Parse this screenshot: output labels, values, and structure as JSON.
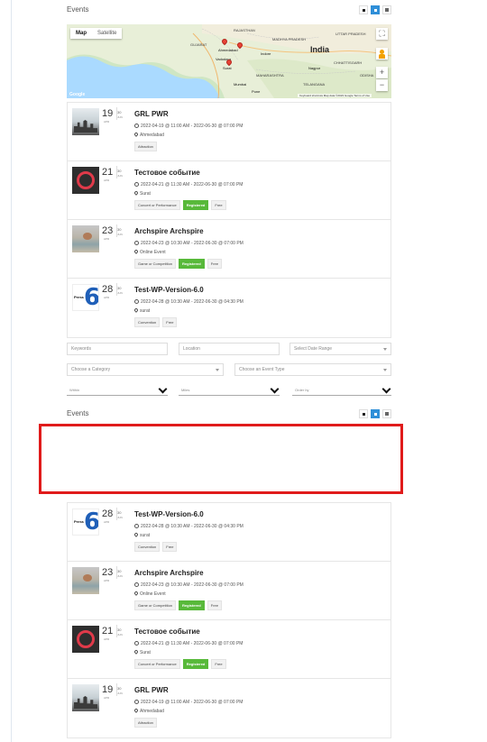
{
  "top_section": {
    "title": "Events",
    "map": {
      "types": [
        "Map",
        "Satellite"
      ],
      "labels": [
        "GUJARAT",
        "Ahmedabad",
        "Surat",
        "MADHYA PRADESH",
        "India",
        "MAHARASHTRA",
        "Nagpur",
        "Mumbai",
        "Pune",
        "RAJASTHAN",
        "UTTAR PRADESH",
        "CHHATTISGARH",
        "Vadodara",
        "Indore",
        "ODISHA",
        "TELANGANA"
      ],
      "footer": "Keyboard shortcuts  Map data ©2023 Google  Terms of Use"
    },
    "events": [
      {
        "day": "19",
        "month": "APR",
        "end_day": "30",
        "end_month": "JUN",
        "title": "GRL PWR",
        "time": "2022-04-19 @ 11:00 AM - 2022-06-30 @ 07:00 PM",
        "location": "Ahmedabad",
        "tags": [
          "Attraction"
        ],
        "registered": false,
        "thumb": "city"
      },
      {
        "day": "21",
        "month": "APR",
        "end_day": "30",
        "end_month": "JUN",
        "title": "Тестовое событие",
        "time": "2022-04-21 @ 11:30 AM - 2022-06-30 @ 07:00 PM",
        "location": "Surat",
        "tags": [
          "Concert or Performance",
          "Registered",
          "Free"
        ],
        "registered": true,
        "thumb": "ring"
      },
      {
        "day": "23",
        "month": "APR",
        "end_day": "30",
        "end_month": "JUN",
        "title": "Archspire Archspire",
        "time": "2022-04-23 @ 10:30 AM - 2022-06-30 @ 07:00 PM",
        "location": "Online Event",
        "tags": [
          "Game or Competition",
          "Registered",
          "Free"
        ],
        "registered": true,
        "thumb": "beach"
      },
      {
        "day": "28",
        "month": "APR",
        "end_day": "30",
        "end_month": "JUN",
        "title": "Test-WP-Version-6.0",
        "time": "2022-04-28 @ 10:30 AM - 2022-06-30 @ 04:30 PM",
        "location": "surat",
        "tags": [
          "Convention",
          "Free"
        ],
        "registered": false,
        "thumb": "logo"
      }
    ]
  },
  "filters": {
    "keywords_placeholder": "Keywords",
    "location_placeholder": "Location",
    "date_range": "Select Date Range",
    "category": "Choose a Category",
    "event_type": "Choose an Event Type",
    "within": "Within",
    "miles": "Miles",
    "order_by": "Order by"
  },
  "bottom_section": {
    "title": "Events",
    "events": [
      {
        "day": "28",
        "month": "APR",
        "end_day": "30",
        "end_month": "JUN",
        "title": "Test-WP-Version-6.0",
        "time": "2022-04-28 @ 10:30 AM - 2022-06-30 @ 04:30 PM",
        "location": "surat",
        "tags": [
          "Convention",
          "Free"
        ],
        "thumb": "logo"
      },
      {
        "day": "23",
        "month": "APR",
        "end_day": "30",
        "end_month": "JUN",
        "title": "Archspire Archspire",
        "time": "2022-04-23 @ 10:30 AM - 2022-06-30 @ 07:00 PM",
        "location": "Online Event",
        "tags": [
          "Game or Competition",
          "Registered",
          "Free"
        ],
        "thumb": "beach"
      },
      {
        "day": "21",
        "month": "APR",
        "end_day": "30",
        "end_month": "JUN",
        "title": "Тестовое событие",
        "time": "2022-04-21 @ 11:30 AM - 2022-06-30 @ 07:00 PM",
        "location": "Surat",
        "tags": [
          "Concert or Performance",
          "Registered",
          "Free"
        ],
        "thumb": "ring"
      },
      {
        "day": "19",
        "month": "APR",
        "end_day": "30",
        "end_month": "JUN",
        "title": "GRL PWR",
        "time": "2022-04-19 @ 11:00 AM - 2022-06-30 @ 07:00 PM",
        "location": "Ahmedabad",
        "tags": [
          "Attraction"
        ],
        "thumb": "city"
      }
    ]
  },
  "logo_word": "Press",
  "colors": {
    "accent": "#2f8fd8",
    "registered": "#58b93a",
    "highlight": "#e01b1b"
  }
}
